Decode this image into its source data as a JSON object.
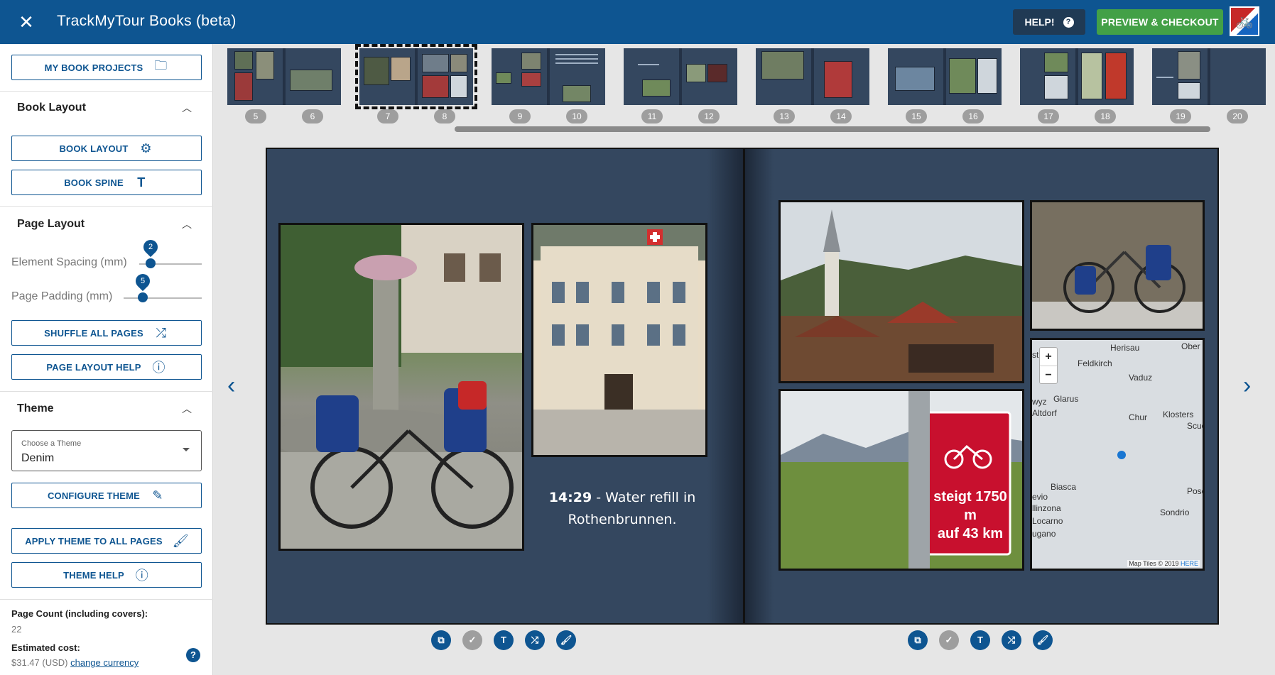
{
  "header": {
    "title": "TrackMyTour Books (beta)",
    "help_label": "HELP!",
    "checkout_label": "PREVIEW & CHECKOUT"
  },
  "sidebar": {
    "my_projects": "MY BOOK PROJECTS",
    "book_layout_section": "Book Layout",
    "book_layout_btn": "BOOK LAYOUT",
    "book_spine_btn": "BOOK SPINE",
    "page_layout_section": "Page Layout",
    "element_spacing_label": "Element Spacing (mm)",
    "element_spacing_value": "2",
    "page_padding_label": "Page Padding (mm)",
    "page_padding_value": "5",
    "shuffle_btn": "SHUFFLE ALL PAGES",
    "page_layout_help_btn": "PAGE LAYOUT HELP",
    "theme_section": "Theme",
    "theme_select_label": "Choose a Theme",
    "theme_select_value": "Denim",
    "configure_theme_btn": "CONFIGURE THEME",
    "apply_theme_btn": "APPLY THEME TO ALL PAGES",
    "theme_help_btn": "THEME HELP",
    "page_count_label": "Page Count (including covers):",
    "page_count_value": "22",
    "cost_label": "Estimated cost:",
    "cost_value": "$31.47 (USD)",
    "change_currency": "change currency"
  },
  "thumbnails": {
    "page_numbers": [
      "5",
      "6",
      "7",
      "8",
      "9",
      "10",
      "11",
      "12",
      "13",
      "14",
      "15",
      "16",
      "17",
      "18",
      "19",
      "20"
    ]
  },
  "spread": {
    "caption_time": "14:29",
    "caption_text": " - Water refill in Rothenbrunnen.",
    "sign_line1": "steigt 1750 m",
    "sign_line2": "auf 43 km",
    "map": {
      "labels": [
        "Herisau",
        "Feldkirch",
        "Vaduz",
        "Glarus",
        "Altdorf",
        "Chur",
        "Klosters",
        "Biasca",
        "Locarno",
        "Sondrio",
        "Ober",
        "Scuo",
        "Posc",
        "llinzona",
        "evio",
        "ugano",
        "wyz",
        "st"
      ],
      "zoom_in": "+",
      "zoom_out": "−",
      "attribution": "Map Tiles © 2019",
      "attribution_link": "HERE"
    }
  },
  "colors": {
    "header": "#0e5591",
    "page_bg": "#34475f",
    "checkout": "#43a047"
  }
}
